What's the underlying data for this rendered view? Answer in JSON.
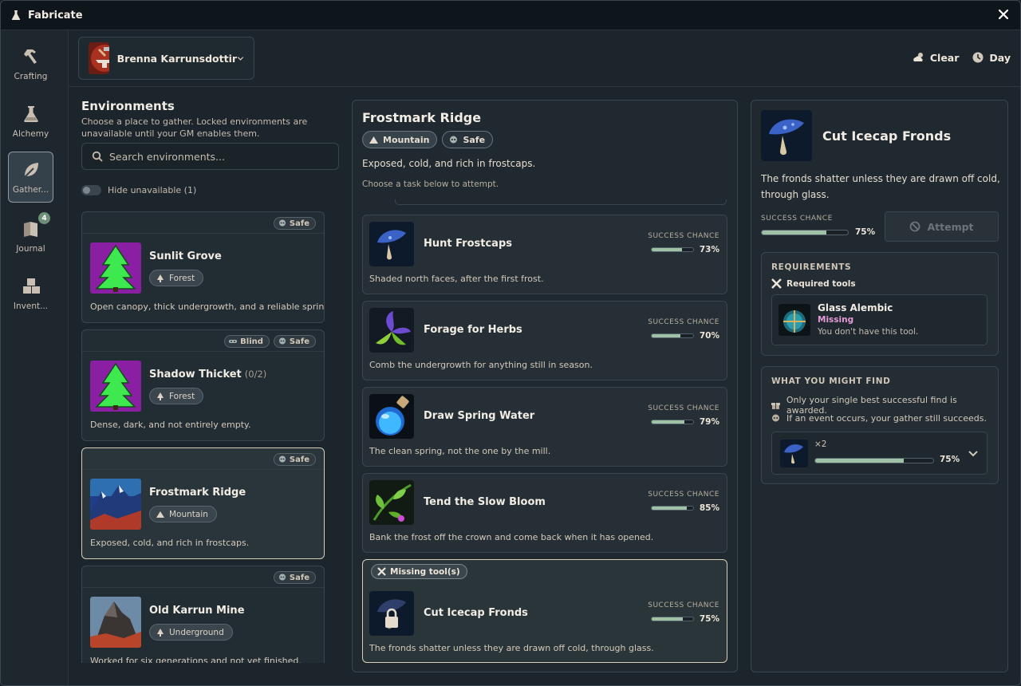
{
  "app": {
    "title": "Fabricate"
  },
  "nav": {
    "items": [
      {
        "label": "Crafting",
        "icon": "hammer-icon"
      },
      {
        "label": "Alchemy",
        "icon": "flask-icon"
      },
      {
        "label": "Gather...",
        "icon": "leaf-icon",
        "active": true
      },
      {
        "label": "Journal",
        "icon": "book-icon",
        "badge": "4"
      },
      {
        "label": "Invent...",
        "icon": "boxes-icon"
      }
    ]
  },
  "character": {
    "name": "Brenna Karrunsdottir"
  },
  "conditions": {
    "weather": "Clear",
    "time": "Day"
  },
  "environments": {
    "title": "Environments",
    "description": "Choose a place to gather. Locked environments are unavailable until your GM enables them.",
    "search_placeholder": "Search environments...",
    "hide_label": "Hide unavailable (1)",
    "cards": [
      {
        "name": "Sunlit Grove",
        "count": "",
        "biome": "Forest",
        "tags": [
          "Safe"
        ],
        "description": "Open canopy, thick undergrowth, and a reliable spring."
      },
      {
        "name": "Shadow Thicket",
        "count": "(0/2)",
        "biome": "Forest",
        "tags": [
          "Blind",
          "Safe"
        ],
        "description": "Dense, dark, and not entirely empty."
      },
      {
        "name": "Frostmark Ridge",
        "count": "",
        "biome": "Mountain",
        "tags": [
          "Safe"
        ],
        "description": "Exposed, cold, and rich in frostcaps.",
        "selected": true
      },
      {
        "name": "Old Karrun Mine",
        "count": "",
        "biome": "Underground",
        "tags": [
          "Safe"
        ],
        "description": "Worked for six generations and not yet finished."
      }
    ]
  },
  "location": {
    "title": "Frostmark Ridge",
    "biome": "Mountain",
    "danger": "Safe",
    "description": "Exposed, cold, and rich in frostcaps.",
    "hint": "Choose a task below to attempt.",
    "success_label": "SUCCESS CHANCE",
    "tasks": [
      {
        "name": "Hunt Frostcaps",
        "chance": 73,
        "chance_text": "73%",
        "description": "Shaded north faces, after the first frost."
      },
      {
        "name": "Forage for Herbs",
        "chance": 70,
        "chance_text": "70%",
        "description": "Comb the undergrowth for anything still in season."
      },
      {
        "name": "Draw Spring Water",
        "chance": 79,
        "chance_text": "79%",
        "description": "The clean spring, not the one by the mill."
      },
      {
        "name": "Tend the Slow Bloom",
        "chance": 85,
        "chance_text": "85%",
        "description": "Bank the frost off the crown and come back when it has opened."
      },
      {
        "name": "Cut Icecap Fronds",
        "chance": 75,
        "chance_text": "75%",
        "description": "The fronds shatter unless they are drawn off cold, through glass.",
        "warning": "Missing tool(s)",
        "selected": true
      }
    ]
  },
  "detail": {
    "title": "Cut Icecap Fronds",
    "description": "The fronds shatter unless they are drawn off cold, through glass.",
    "success_label": "SUCCESS CHANCE",
    "chance": 75,
    "chance_text": "75%",
    "attempt_label": "Attempt",
    "requirements": {
      "title": "REQUIREMENTS",
      "tools_label": "Required tools",
      "tool": {
        "name": "Glass Alembic",
        "status": "Missing",
        "note": "You don't have this tool."
      }
    },
    "finds": {
      "title": "WHAT YOU MIGHT FIND",
      "rule1": "Only your single best successful find is awarded.",
      "rule2": "If an event occurs, your gather still succeeds.",
      "item": {
        "count": "×2",
        "chance": 75,
        "chance_text": "75%"
      }
    }
  },
  "colors": {
    "accent_green": "#9fc2a6",
    "missing_pink": "#e59ad8",
    "selected_border": "#d8cfb8"
  }
}
